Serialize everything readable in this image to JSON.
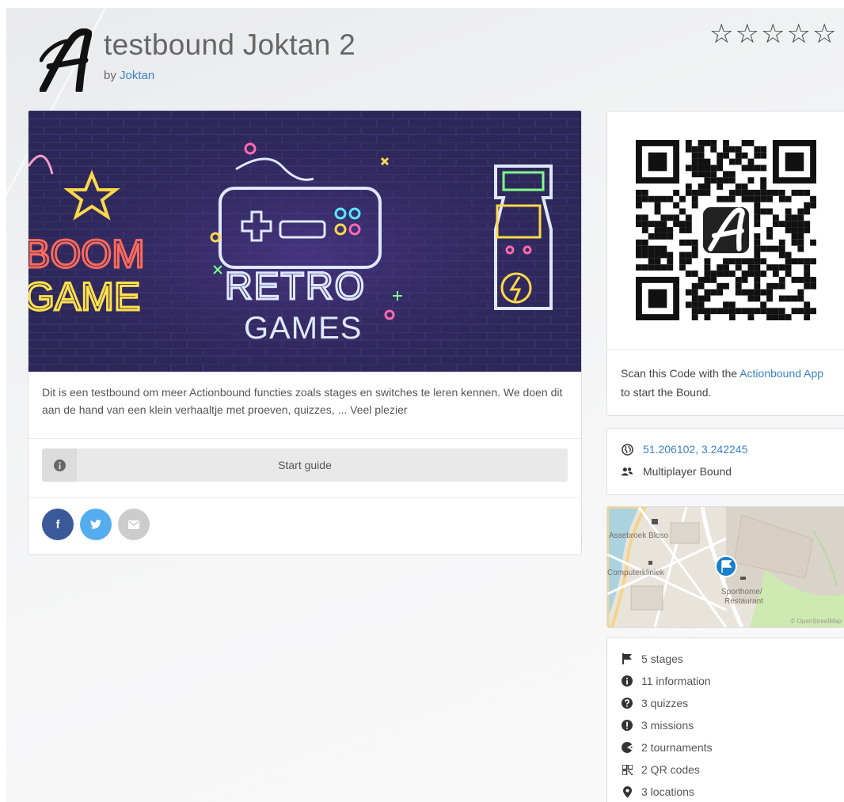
{
  "header": {
    "title": "testbound Joktan 2",
    "by_label": "by",
    "author": "Joktan",
    "rating_stars": 0,
    "stars_total": 5
  },
  "hero": {
    "sign_left_line1": "BOOM",
    "sign_left_line2": "GAME",
    "sign_center_line1": "RETRO",
    "sign_center_line2": "GAMES"
  },
  "description": "Dit is een testbound om meer Actionbound functies zoals stages en switches te leren kennen. We doen dit aan de hand van een klein verhaaltje met proeven, quizzes, ... Veel plezier",
  "start_button": {
    "label": "Start guide",
    "icon": "info-icon"
  },
  "share": [
    {
      "name": "facebook",
      "glyph": "f",
      "color": "#3b5998"
    },
    {
      "name": "twitter",
      "glyph": "❧",
      "color": "#55acee"
    },
    {
      "name": "email",
      "glyph": "✉",
      "color": "#cccccc"
    }
  ],
  "qr": {
    "text_before": "Scan this Code with the ",
    "link": "Actionbound App",
    "text_after": " to start the Bound."
  },
  "location": {
    "coords": "51.206102, 3.242245",
    "mode": "Multiplayer Bound"
  },
  "map": {
    "labels": [
      "Assebroek Bloso",
      "Computerkliniek",
      "Sporthome/\nRestaurant"
    ],
    "attribution": "© OpenStreetMap"
  },
  "stats": [
    {
      "icon": "flag-icon",
      "text": "5 stages"
    },
    {
      "icon": "info-icon",
      "text": "11 information"
    },
    {
      "icon": "question-icon",
      "text": "3 quizzes"
    },
    {
      "icon": "exclamation-icon",
      "text": "3 missions"
    },
    {
      "icon": "pacman-icon",
      "text": "2 tournaments"
    },
    {
      "icon": "qrcode-icon",
      "text": "2 QR codes"
    },
    {
      "icon": "map-marker-icon",
      "text": "3 locations"
    }
  ],
  "colors": {
    "link": "#3b82c4",
    "facebook": "#3b5998",
    "twitter": "#55acee",
    "map_marker": "#1a7fc9"
  }
}
